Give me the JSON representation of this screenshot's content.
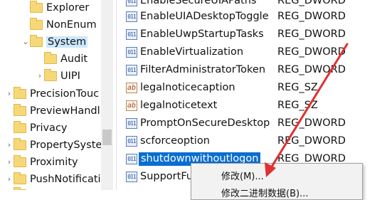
{
  "tree": {
    "items": [
      {
        "label": "Explorer",
        "expander": ""
      },
      {
        "label": "NonEnum",
        "expander": ""
      },
      {
        "label": "System",
        "expander": "⌄"
      },
      {
        "label": "Audit",
        "expander": ""
      },
      {
        "label": "UIPI",
        "expander": "›"
      },
      {
        "label": "PrecisionTouc",
        "expander": "›"
      },
      {
        "label": "PreviewHandl",
        "expander": ""
      },
      {
        "label": "Privacy",
        "expander": ""
      },
      {
        "label": "PropertySyste",
        "expander": "›"
      },
      {
        "label": "Proximity",
        "expander": "›"
      },
      {
        "label": "PushNotificati",
        "expander": "›"
      }
    ]
  },
  "values": {
    "rows": [
      {
        "name": "EnableSecureUIAPaths",
        "type": "REG_DWORD",
        "icon": "dword-icon",
        "glyph": "011"
      },
      {
        "name": "EnableUIADesktopToggle",
        "type": "REG_DWORD",
        "icon": "dword-icon",
        "glyph": "011"
      },
      {
        "name": "EnableUwpStartupTasks",
        "type": "REG_DWORD",
        "icon": "dword-icon",
        "glyph": "011"
      },
      {
        "name": "EnableVirtualization",
        "type": "REG_DWORD",
        "icon": "dword-icon",
        "glyph": "011"
      },
      {
        "name": "FilterAdministratorToken",
        "type": "REG_DWORD",
        "icon": "dword-icon",
        "glyph": "011"
      },
      {
        "name": "legalnoticecaption",
        "type": "REG_SZ",
        "icon": "string-icon",
        "glyph": "ab"
      },
      {
        "name": "legalnoticetext",
        "type": "REG_SZ",
        "icon": "string-icon",
        "glyph": "ab"
      },
      {
        "name": "PromptOnSecureDesktop",
        "type": "REG_DWORD",
        "icon": "dword-icon",
        "glyph": "011"
      },
      {
        "name": "scforceoption",
        "type": "REG_DWORD",
        "icon": "dword-icon",
        "glyph": "011"
      },
      {
        "name": "shutdownwithoutlogon",
        "type": "REG_DWORD",
        "icon": "dword-icon",
        "glyph": "011"
      },
      {
        "name": "SupportFu",
        "type": "",
        "icon": "dword-icon",
        "glyph": "011"
      }
    ]
  },
  "context_menu": {
    "modify": "修改(M)...",
    "modify_binary": "修改二进制数据(B)..."
  },
  "colors": {
    "selection": "#0a6ed1",
    "folder": "#f6d879",
    "annotation_arrow": "#e03030"
  }
}
